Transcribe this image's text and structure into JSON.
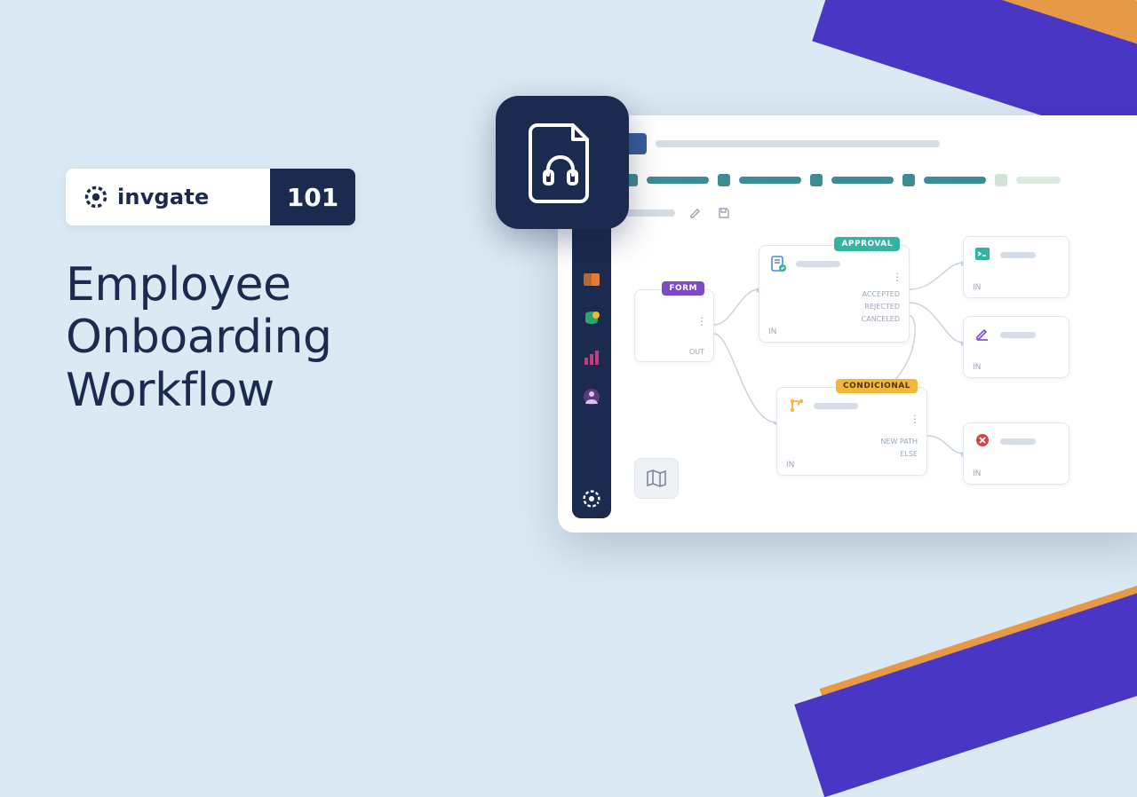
{
  "brand": {
    "name": "invgate",
    "badge": "101"
  },
  "headline": "Employee Onboarding Workflow",
  "colors": {
    "navy": "#1b2a4e",
    "pale": "#dbe9f4",
    "purple": "#7d4bc8",
    "teal": "#34b3a0",
    "yellow": "#f5b638",
    "orange_stripe": "#e69a45",
    "blue_stripe": "#4a36c5"
  },
  "workflow": {
    "form": {
      "badge": "FORM",
      "out_label": "OUT"
    },
    "approval": {
      "badge": "APPROVAL",
      "in_label": "IN",
      "outputs": [
        "ACCEPTED",
        "REJECTED",
        "CANCELED"
      ]
    },
    "conditional": {
      "badge": "CONDICIONAL",
      "in_label": "IN",
      "outputs": [
        "NEW PATH",
        "ELSE"
      ]
    },
    "task_a": {
      "in_label": "IN"
    },
    "task_b": {
      "in_label": "IN"
    },
    "task_c": {
      "in_label": "IN"
    }
  },
  "icons": {
    "feature": "file-headset-icon",
    "sidebar": [
      "ticket-icon",
      "database-icon",
      "chart-icon",
      "logo-icon"
    ]
  }
}
